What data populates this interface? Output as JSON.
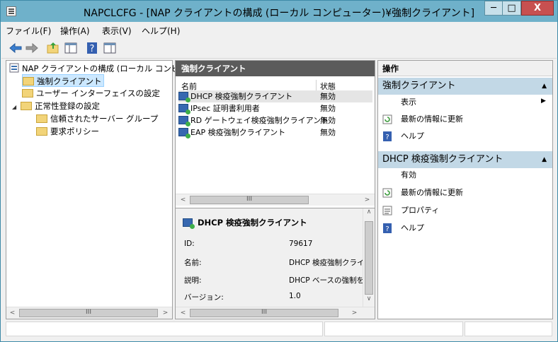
{
  "window": {
    "title": "NAPCLCFG - [NAP クライアントの構成 (ローカル コンピューター)¥強制クライアント]",
    "minimize": "─",
    "maximize": "□",
    "close": "X"
  },
  "menu": [
    "ファイル(F)",
    "操作(A)",
    "表示(V)",
    "ヘルプ(H)"
  ],
  "tree": {
    "root": "NAP クライアントの構成 (ローカル コンピュー",
    "items": [
      {
        "label": "強制クライアント",
        "selected": true
      },
      {
        "label": "ユーザー インターフェイスの設定"
      },
      {
        "label": "正常性登録の設定",
        "expand": "◢"
      },
      {
        "label": "信頼されたサーバー グループ"
      },
      {
        "label": "要求ポリシー"
      }
    ]
  },
  "center": {
    "header": "強制クライアント",
    "columns": [
      "名前",
      "状態"
    ],
    "rows": [
      {
        "name": "DHCP 検疫強制クライアント",
        "status": "無効"
      },
      {
        "name": "IPsec 証明書利用者",
        "status": "無効"
      },
      {
        "name": "RD ゲートウェイ検疫強制クライアント",
        "status": "無効"
      },
      {
        "name": "EAP 検疫強制クライアント",
        "status": "無効"
      }
    ],
    "detail": {
      "title": "DHCP 検疫強制クライアント",
      "fields": [
        {
          "label": "ID:",
          "value": "79617"
        },
        {
          "label": "名前:",
          "value": "DHCP 検疫強制クライ"
        },
        {
          "label": "説明:",
          "value": "DHCP ベースの強制を"
        },
        {
          "label": "バージョン:",
          "value": "1.0"
        }
      ]
    },
    "scroll_thumb": "III"
  },
  "actions": {
    "header": "操作",
    "section1": {
      "title": "強制クライアント",
      "items": [
        "表示",
        "最新の情報に更新",
        "ヘルプ"
      ]
    },
    "section2": {
      "title": "DHCP 検疫強制クライアント",
      "items": [
        "有効",
        "最新の情報に更新",
        "プロパティ",
        "ヘルプ"
      ]
    }
  }
}
